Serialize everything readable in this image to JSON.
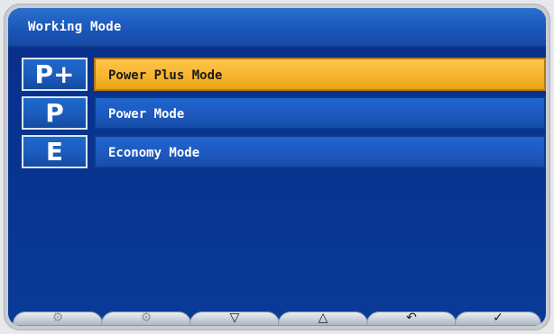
{
  "header": {
    "title": "Working Mode"
  },
  "modes": [
    {
      "badge": "P+",
      "label": "Power Plus Mode",
      "selected": true
    },
    {
      "badge": "P",
      "label": "Power Mode",
      "selected": false
    },
    {
      "badge": "E",
      "label": "Economy Mode",
      "selected": false
    }
  ],
  "toolbar": {
    "buttons": [
      {
        "name": "tool1-icon",
        "glyph": "⚙",
        "enabled": false
      },
      {
        "name": "tool2-icon",
        "glyph": "⚙",
        "enabled": false
      },
      {
        "name": "arrow-down-icon",
        "glyph": "▽",
        "enabled": true
      },
      {
        "name": "arrow-up-icon",
        "glyph": "△",
        "enabled": true
      },
      {
        "name": "back-icon",
        "glyph": "↶",
        "enabled": true
      },
      {
        "name": "confirm-icon",
        "glyph": "✓",
        "enabled": true
      }
    ]
  },
  "colors": {
    "screen_bg": "#0a2f8a",
    "header_blue": "#1a57b8",
    "row_blue": "#1d59bf",
    "selected_yellow": "#f7b530"
  }
}
